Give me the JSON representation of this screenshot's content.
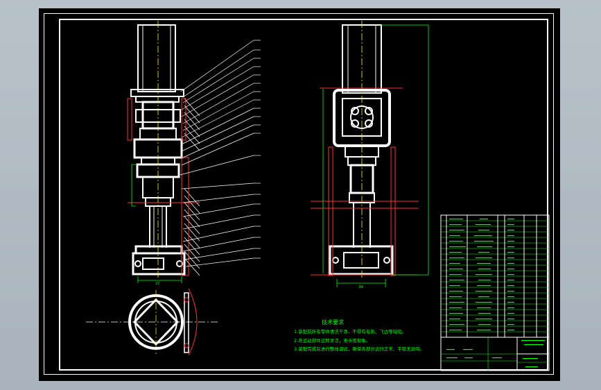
{
  "technical_requirements": {
    "title": "技术要求",
    "items": [
      "1.装配前所有零件清洗干净，不得有毛刺、飞边等缺陷。",
      "2.各运动部件运转灵活，无卡阻现象。",
      "3.装配完成后进行整体调试，确保各部分运行正常、平稳无异响。"
    ]
  },
  "dimensions": {
    "left_width": "22",
    "right_width": "84"
  },
  "colors": {
    "line": "#ffffff",
    "centerline": "#ffff00",
    "dimension": "#00ff00",
    "section": "#ff3030"
  }
}
